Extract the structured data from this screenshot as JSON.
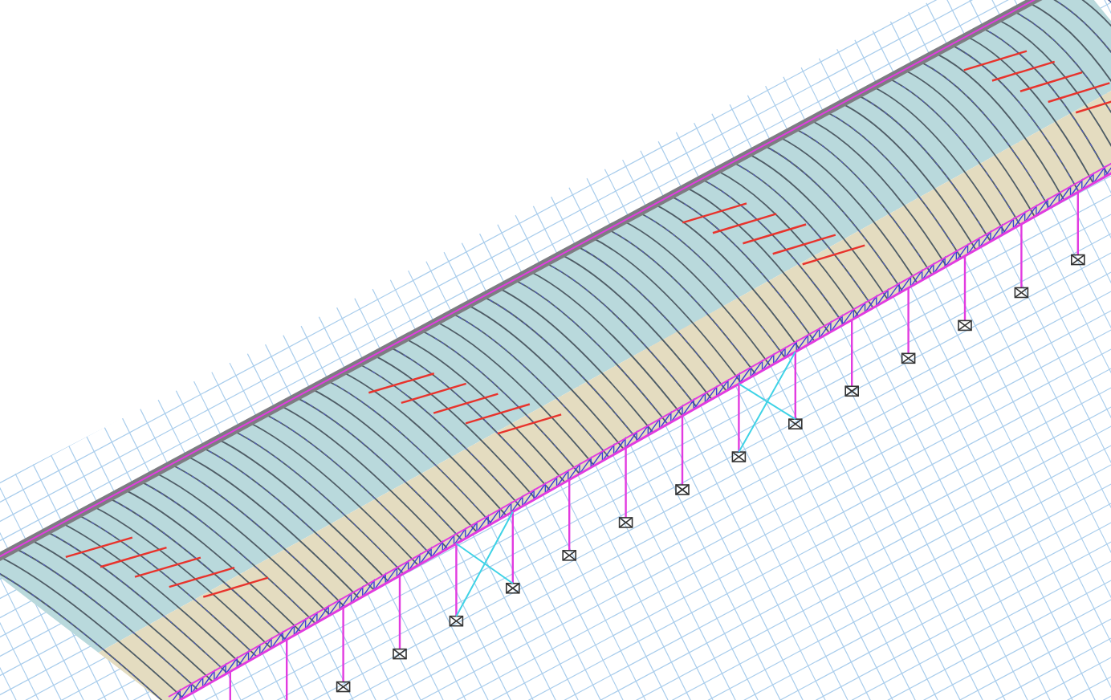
{
  "viewport": {
    "kind": "arched-truss-model"
  }
}
